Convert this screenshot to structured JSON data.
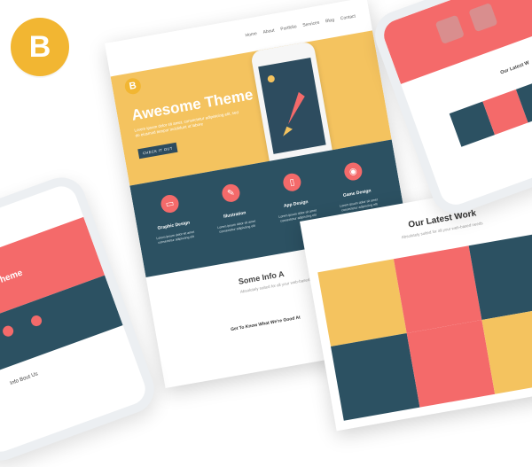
{
  "brand": {
    "letter": "B"
  },
  "nav": {
    "items": [
      "Home",
      "About",
      "Portfolio",
      "Services",
      "Blog",
      "Contact"
    ]
  },
  "hero": {
    "title": "Awesome Theme",
    "subtitle": "Lorem ipsum dolor sit amet, consectetur adipisicing elit, sed do eiusmod tempor incididunt ut labore",
    "button": "CHECK IT OUT"
  },
  "features": [
    {
      "title": "Graphic Design",
      "desc": "Lorem ipsum dolor sit amet consectetur adipiscing elit",
      "icon": "monitor-icon"
    },
    {
      "title": "Illustration",
      "desc": "Lorem ipsum dolor sit amet consectetur adipiscing elit",
      "icon": "pencil-icon"
    },
    {
      "title": "App Design",
      "desc": "Lorem ipsum dolor sit amet consectetur adipiscing elit",
      "icon": "mobile-icon"
    },
    {
      "title": "Game Design",
      "desc": "Lorem ipsum dolor sit amet consectetur adipiscing elit",
      "icon": "gamepad-icon"
    }
  ],
  "info": {
    "title": "Some Info A",
    "subtitle": "Absolutely suited for all your web-based needs",
    "heading": "Get To Know What We're Good At"
  },
  "portfolio": {
    "title": "Our Latest Work",
    "subtitle": "Absolutely suited for all your web-based needs",
    "tile_colors": [
      "#f4c35f",
      "#f46a6a",
      "#2c5162",
      "#2c5162",
      "#f46a6a",
      "#f4c35f"
    ]
  },
  "phone_right": {
    "title": "Our Latest W"
  },
  "phone_left": {
    "title": "ome Theme",
    "footer": "Info Bout Us"
  },
  "colors": {
    "yellow": "#f4c35f",
    "teal": "#2c5162",
    "coral": "#f46a6a",
    "brand": "#f2b632"
  }
}
